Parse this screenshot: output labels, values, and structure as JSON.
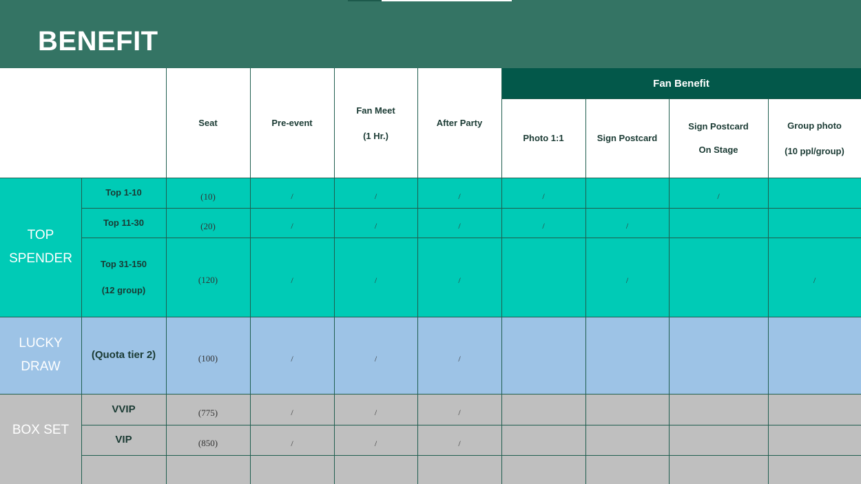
{
  "title": "BENEFIT",
  "colors": {
    "header_bar": "#347464",
    "fan_benefit_header": "#03584a",
    "top_spender": "#00cbb6",
    "lucky_draw": "#9dc3e6",
    "box_set": "#bfbfbf",
    "grid": "#1f5e4f"
  },
  "headers": {
    "fan_benefit": "Fan Benefit",
    "seat": "Seat",
    "pre_event": "Pre-event",
    "fan_meet_1": "Fan Meet",
    "fan_meet_2": "(1 Hr.)",
    "after_party": "After Party",
    "photo": "Photo 1:1",
    "sign_postcard": "Sign Postcard",
    "sign_postcard_stage_1": "Sign Postcard",
    "sign_postcard_stage_2": "On Stage",
    "group_photo_1": "Group photo",
    "group_photo_2": "(10 ppl/group)"
  },
  "sections": {
    "top_spender_1": "TOP",
    "top_spender_2": "SPENDER",
    "lucky_draw_1": "LUCKY",
    "lucky_draw_2": "DRAW",
    "box_set": "BOX SET"
  },
  "rows": [
    {
      "label": "Top 1-10",
      "label2": "",
      "seat": "(10)",
      "pre_event": "/",
      "fan_meet": "/",
      "after_party": "/",
      "photo": "/",
      "sign_postcard": "",
      "sign_postcard_stage": "/",
      "group_photo": ""
    },
    {
      "label": "Top 11-30",
      "label2": "",
      "seat": "(20)",
      "pre_event": "/",
      "fan_meet": "/",
      "after_party": "/",
      "photo": "/",
      "sign_postcard": "/",
      "sign_postcard_stage": "",
      "group_photo": ""
    },
    {
      "label": "Top 31-150",
      "label2": "(12 group)",
      "seat": "(120)",
      "pre_event": "/",
      "fan_meet": "/",
      "after_party": "/",
      "photo": "",
      "sign_postcard": "/",
      "sign_postcard_stage": "",
      "group_photo": "/"
    },
    {
      "label": "(Quota tier 2)",
      "label2": "",
      "seat": "(100)",
      "pre_event": "/",
      "fan_meet": "/",
      "after_party": "/",
      "photo": "",
      "sign_postcard": "",
      "sign_postcard_stage": "",
      "group_photo": ""
    },
    {
      "label": "VVIP",
      "label2": "",
      "seat": "(775)",
      "pre_event": "/",
      "fan_meet": "/",
      "after_party": "/",
      "photo": "",
      "sign_postcard": "",
      "sign_postcard_stage": "",
      "group_photo": ""
    },
    {
      "label": "VIP",
      "label2": "",
      "seat": "(850)",
      "pre_event": "/",
      "fan_meet": "/",
      "after_party": "/",
      "photo": "",
      "sign_postcard": "",
      "sign_postcard_stage": "",
      "group_photo": ""
    }
  ]
}
